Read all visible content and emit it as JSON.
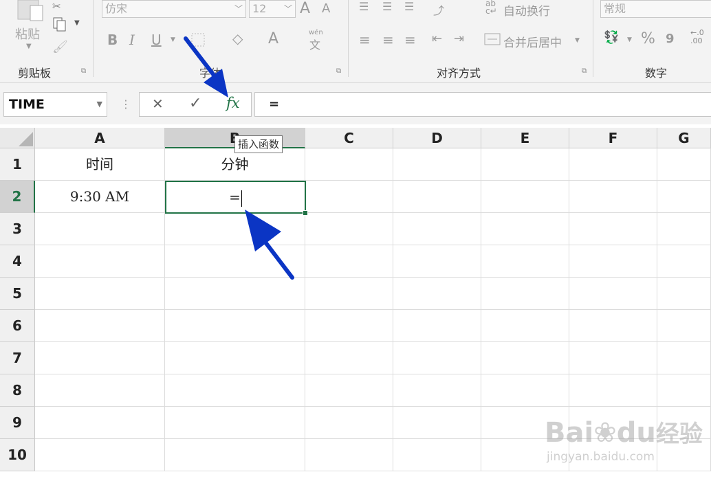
{
  "ribbon": {
    "clipboard": {
      "paste_label": "粘贴",
      "group_label": "剪贴板"
    },
    "font": {
      "font_name": "仿宋",
      "font_size": "12",
      "bold": "B",
      "italic": "I",
      "underline": "U",
      "font_color_glyph": "A",
      "pinyin_label": "wén",
      "pinyin_char": "文",
      "grow_glyph": "A",
      "shrink_glyph": "A",
      "group_label_partial": "字体"
    },
    "alignment": {
      "wrap_text": "自动换行",
      "wrap_prefix": "ab\nc",
      "merge_center": "合并后居中",
      "group_label": "对齐方式"
    },
    "number": {
      "format": "常规",
      "percent": "%",
      "comma": "9",
      "dec_inc": "←.0 .00",
      "group_label": "数字"
    }
  },
  "formula_bar": {
    "name_box": "TIME",
    "cancel_glyph": "✕",
    "enter_glyph": "✓",
    "fx_glyph": "fx",
    "content": "="
  },
  "grid": {
    "columns": [
      "A",
      "B",
      "C",
      "D",
      "E",
      "F",
      "G"
    ],
    "rows": [
      "1",
      "2",
      "3",
      "4",
      "5",
      "6",
      "7",
      "8",
      "9",
      "10"
    ],
    "cells": {
      "A1": "时间",
      "B1": "分钟",
      "A2": "9:30 AM",
      "B2": "="
    }
  },
  "tooltip": "插入函数",
  "watermark": {
    "brand": "Bai",
    "brand2": "du",
    "brand_cn": "经验",
    "url": "jingyan.baidu.com"
  },
  "colors": {
    "accent": "#217346",
    "arrow": "#0b35c4"
  }
}
